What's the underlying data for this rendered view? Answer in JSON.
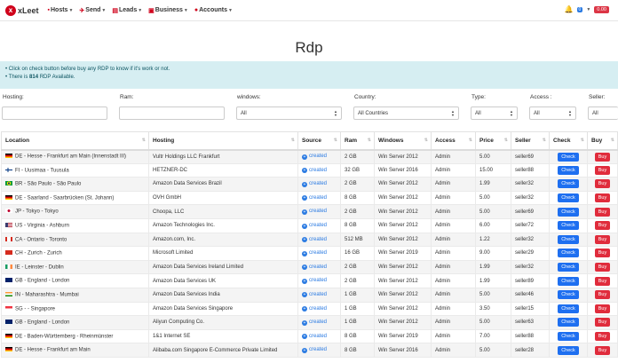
{
  "brand": {
    "logo": "x",
    "name": "xLeet"
  },
  "nav": [
    {
      "label": "Hosts",
      "icon": "server-icon",
      "glyph": "▪"
    },
    {
      "label": "Send",
      "icon": "send-icon",
      "glyph": "✈"
    },
    {
      "label": "Leads",
      "icon": "leads-icon",
      "glyph": "▤"
    },
    {
      "label": "Business",
      "icon": "business-icon",
      "glyph": "▣"
    },
    {
      "label": "Accounts",
      "icon": "user-icon",
      "glyph": "●"
    }
  ],
  "header_right": {
    "notifications": "0",
    "balance": "0.00"
  },
  "page_title": "Rdp",
  "info": {
    "line1": "Click on check button before buy any RDP to know if it's work or not.",
    "line2_pre": "There is ",
    "count": "814",
    "line2_post": " RDP Available."
  },
  "filters": {
    "hosting_label": "Hosting:",
    "ram_label": "Ram:",
    "windows_label": "windows:",
    "windows_value": "All",
    "country_label": "Country:",
    "country_value": "All Countries",
    "type_label": "Type:",
    "type_value": "All",
    "access_label": "Access :",
    "access_value": "All",
    "seller_label": "Seller:",
    "seller_value": "All"
  },
  "columns": [
    "Location",
    "Hosting",
    "Source",
    "Ram",
    "Windows",
    "Access",
    "Price",
    "Seller",
    "Check",
    "Buy"
  ],
  "check_label": "Check",
  "buy_label": "Buy",
  "rows": [
    {
      "flag": "de",
      "location": "DE - Hesse - Frankfurt am Main (Innenstadt III)",
      "hosting": "Vultr Holdings LLC Frankfurt",
      "source": "created",
      "ram": "2 GB",
      "windows": "Win Server 2012",
      "access": "Admin",
      "price": "5.00",
      "seller": "seller69"
    },
    {
      "flag": "fi",
      "location": "FI - Uusimaa - Tuusula",
      "hosting": "HETZNER-DC",
      "source": "created",
      "ram": "32 GB",
      "windows": "Win Server 2016",
      "access": "Admin",
      "price": "15.00",
      "seller": "seller88"
    },
    {
      "flag": "br",
      "location": "BR - São Paulo - São Paulo",
      "hosting": "Amazon Data Services Brazil",
      "source": "created",
      "ram": "2 GB",
      "windows": "Win Server 2012",
      "access": "Admin",
      "price": "1.99",
      "seller": "seller32"
    },
    {
      "flag": "de",
      "location": "DE - Saarland - Saarbrücken (St. Johann)",
      "hosting": "OVH GmbH",
      "source": "created",
      "ram": "8 GB",
      "windows": "Win Server 2012",
      "access": "Admin",
      "price": "5.00",
      "seller": "seller32"
    },
    {
      "flag": "jp",
      "location": "JP - Tokyo - Tokyo",
      "hosting": "Choopa, LLC",
      "source": "created",
      "ram": "2 GB",
      "windows": "Win Server 2012",
      "access": "Admin",
      "price": "5.00",
      "seller": "seller69"
    },
    {
      "flag": "us",
      "location": "US - Virginia - Ashburn",
      "hosting": "Amazon Technologies Inc.",
      "source": "created",
      "ram": "8 GB",
      "windows": "Win Server 2012",
      "access": "Admin",
      "price": "6.00",
      "seller": "seller72"
    },
    {
      "flag": "ca",
      "location": "CA - Ontario - Toronto",
      "hosting": "Amazon.com, Inc.",
      "source": "created",
      "ram": "512 MB",
      "windows": "Win Server 2012",
      "access": "Admin",
      "price": "1.22",
      "seller": "seller32"
    },
    {
      "flag": "ch",
      "location": "CH - Zurich - Zurich",
      "hosting": "Microsoft Limited",
      "source": "created",
      "ram": "16 GB",
      "windows": "Win Server 2019",
      "access": "Admin",
      "price": "9.00",
      "seller": "seller29"
    },
    {
      "flag": "ie",
      "location": "IE - Leinster - Dublin",
      "hosting": "Amazon Data Services Ireland Limited",
      "source": "created",
      "ram": "2 GB",
      "windows": "Win Server 2012",
      "access": "Admin",
      "price": "1.99",
      "seller": "seller32"
    },
    {
      "flag": "gb",
      "location": "GB - England - London",
      "hosting": "Amazon Data Services UK",
      "source": "created",
      "ram": "2 GB",
      "windows": "Win Server 2012",
      "access": "Admin",
      "price": "1.99",
      "seller": "seller89"
    },
    {
      "flag": "in",
      "location": "IN - Maharashtra - Mumbai",
      "hosting": "Amazon Data Services India",
      "source": "created",
      "ram": "1 GB",
      "windows": "Win Server 2012",
      "access": "Admin",
      "price": "5.00",
      "seller": "seller46"
    },
    {
      "flag": "sg",
      "location": "SG - - Singapore",
      "hosting": "Amazon Data Services Singapore",
      "source": "created",
      "ram": "1 GB",
      "windows": "Win Server 2012",
      "access": "Admin",
      "price": "3.50",
      "seller": "seller15"
    },
    {
      "flag": "gb",
      "location": "GB - England - London",
      "hosting": "Aliyun Computing Co.",
      "source": "created",
      "ram": "1 GB",
      "windows": "Win Server 2012",
      "access": "Admin",
      "price": "5.00",
      "seller": "seller63"
    },
    {
      "flag": "de",
      "location": "DE - Baden-Württemberg - Rheinmünster",
      "hosting": "1&1 Internet SE",
      "source": "created",
      "ram": "8 GB",
      "windows": "Win Server 2019",
      "access": "Admin",
      "price": "7.00",
      "seller": "seller88"
    },
    {
      "flag": "de",
      "location": "DE - Hesse - Frankfurt am Main",
      "hosting": "Alibaba.com Singapore E-Commerce Private Limited",
      "source": "created",
      "ram": "8 GB",
      "windows": "Win Server 2016",
      "access": "Admin",
      "price": "5.00",
      "seller": "seller28"
    }
  ],
  "colors": {
    "accent": "#d0021b",
    "check": "#1e6ff0",
    "buy": "#e02c3c",
    "link": "#2a7ae2",
    "info_bg": "#d6eef2"
  }
}
